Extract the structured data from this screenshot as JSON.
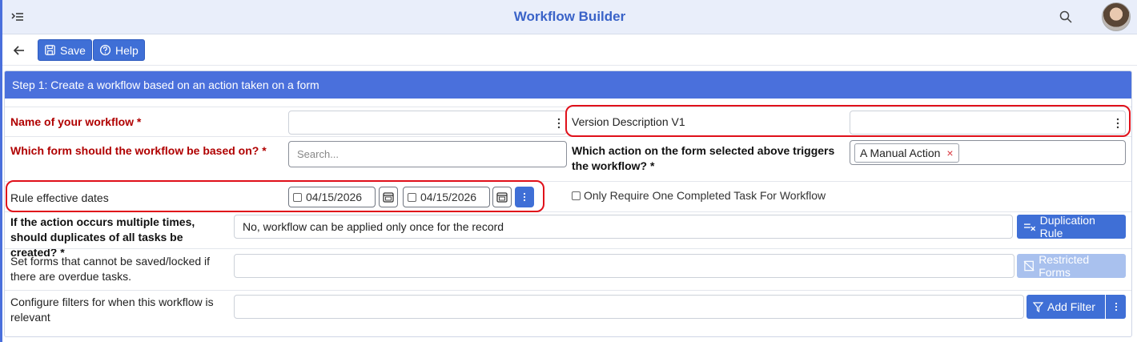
{
  "header": {
    "title": "Workflow Builder",
    "menu_icon": "collapse-menu-icon",
    "search_icon": "search-icon",
    "avatar": "user-avatar"
  },
  "toolbar": {
    "back_icon": "arrow-left-icon",
    "save_label": "Save",
    "help_label": "Help"
  },
  "step": {
    "title": "Step 1: Create a workflow based on an action taken on a form"
  },
  "form": {
    "workflow_name": {
      "label": "Name of your workflow *",
      "value": ""
    },
    "version_description": {
      "label": "Version Description V1",
      "value": ""
    },
    "based_on_form": {
      "label": "Which form should the workflow be based on? *",
      "placeholder": "Search..."
    },
    "trigger_action": {
      "label": "Which action on the form selected above triggers the workflow? *",
      "chip": "A Manual Action",
      "chip_remove": "×"
    },
    "effective_dates": {
      "label": "Rule effective dates",
      "start": "04/15/2026",
      "end": "04/15/2026"
    },
    "one_completed_task": {
      "label": "Only Require One Completed Task For Workflow",
      "checked": false
    },
    "duplicates": {
      "label": "If the action occurs multiple times, should duplicates of all tasks be created? *",
      "value": "No, workflow can be applied only once for the record",
      "button": "Duplication Rule"
    },
    "restricted": {
      "label": "Set forms that cannot be saved/locked if there are overdue tasks.",
      "value": "",
      "button": "Restricted Forms"
    },
    "filters": {
      "label": "Configure filters for when this workflow is relevant",
      "value": "",
      "button": "Add Filter"
    }
  },
  "colors": {
    "accent": "#3f6fd6",
    "header_bg": "#4a70dc",
    "required": "#b00000",
    "highlight": "#e0101a"
  }
}
